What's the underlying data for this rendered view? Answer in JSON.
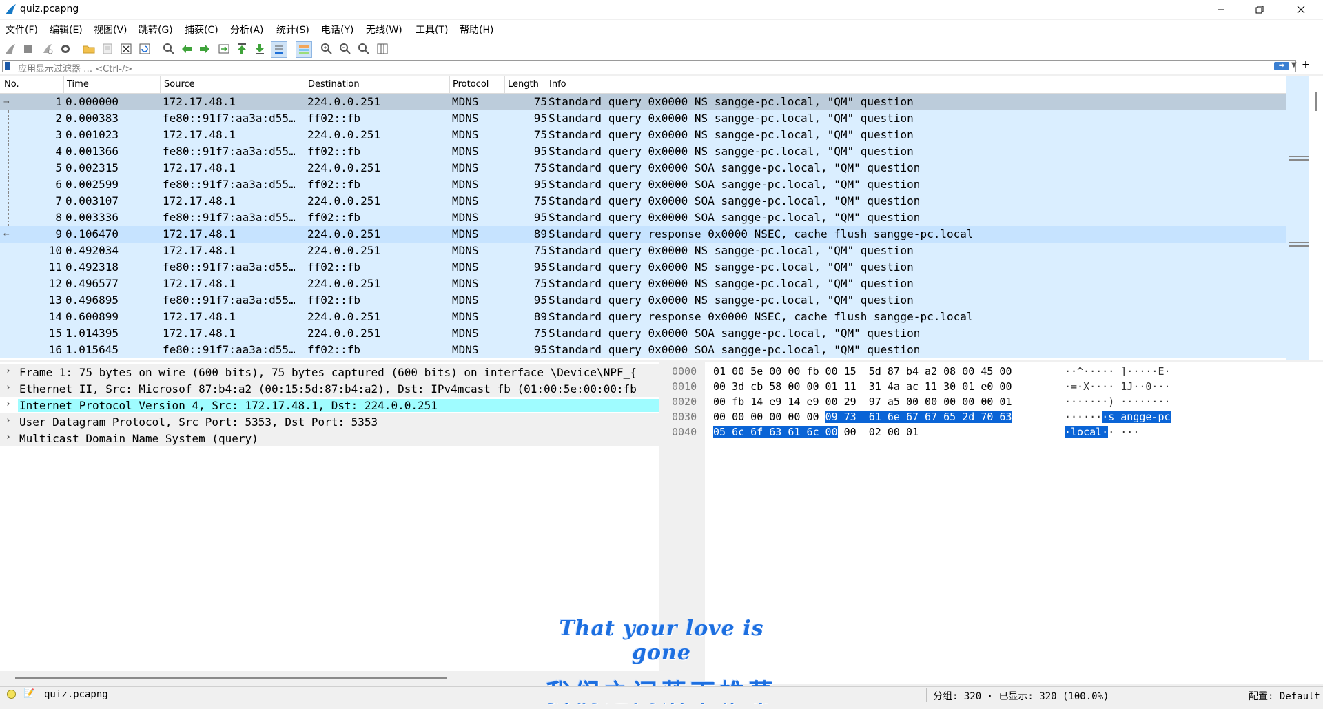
{
  "window": {
    "title": "quiz.pcapng"
  },
  "menu": [
    "文件(F)",
    "编辑(E)",
    "视图(V)",
    "跳转(G)",
    "捕获(C)",
    "分析(A)",
    "统计(S)",
    "电话(Y)",
    "无线(W)",
    "工具(T)",
    "帮助(H)"
  ],
  "toolbar": [
    "start-capture",
    "stop-capture",
    "restart-capture",
    "capture-options",
    "open-file",
    "save-file",
    "close-file",
    "reload-file",
    "find-packet",
    "go-back",
    "go-forward",
    "go-to-packet",
    "go-first",
    "go-last",
    "auto-scroll",
    "colorize",
    "zoom-in",
    "zoom-out",
    "zoom-normal",
    "resize-columns"
  ],
  "filter": {
    "placeholder": "应用显示过滤器 … <Ctrl-/>"
  },
  "packet_list": {
    "columns": [
      "No.",
      "Time",
      "Source",
      "Destination",
      "Protocol",
      "Length",
      "Info"
    ],
    "rows": [
      {
        "no": "1",
        "time": "0.000000",
        "src": "172.17.48.1",
        "dst": "224.0.0.251",
        "proto": "MDNS",
        "len": "75",
        "info": "Standard query 0x0000 NS sangge-pc.local, \"QM\" question"
      },
      {
        "no": "2",
        "time": "0.000383",
        "src": "fe80::91f7:aa3a:d55…",
        "dst": "ff02::fb",
        "proto": "MDNS",
        "len": "95",
        "info": "Standard query 0x0000 NS sangge-pc.local, \"QM\" question"
      },
      {
        "no": "3",
        "time": "0.001023",
        "src": "172.17.48.1",
        "dst": "224.0.0.251",
        "proto": "MDNS",
        "len": "75",
        "info": "Standard query 0x0000 NS sangge-pc.local, \"QM\" question"
      },
      {
        "no": "4",
        "time": "0.001366",
        "src": "fe80::91f7:aa3a:d55…",
        "dst": "ff02::fb",
        "proto": "MDNS",
        "len": "95",
        "info": "Standard query 0x0000 NS sangge-pc.local, \"QM\" question"
      },
      {
        "no": "5",
        "time": "0.002315",
        "src": "172.17.48.1",
        "dst": "224.0.0.251",
        "proto": "MDNS",
        "len": "75",
        "info": "Standard query 0x0000 SOA sangge-pc.local, \"QM\" question"
      },
      {
        "no": "6",
        "time": "0.002599",
        "src": "fe80::91f7:aa3a:d55…",
        "dst": "ff02::fb",
        "proto": "MDNS",
        "len": "95",
        "info": "Standard query 0x0000 SOA sangge-pc.local, \"QM\" question"
      },
      {
        "no": "7",
        "time": "0.003107",
        "src": "172.17.48.1",
        "dst": "224.0.0.251",
        "proto": "MDNS",
        "len": "75",
        "info": "Standard query 0x0000 SOA sangge-pc.local, \"QM\" question"
      },
      {
        "no": "8",
        "time": "0.003336",
        "src": "fe80::91f7:aa3a:d55…",
        "dst": "ff02::fb",
        "proto": "MDNS",
        "len": "95",
        "info": "Standard query 0x0000 SOA sangge-pc.local, \"QM\" question"
      },
      {
        "no": "9",
        "time": "0.106470",
        "src": "172.17.48.1",
        "dst": "224.0.0.251",
        "proto": "MDNS",
        "len": "89",
        "info": "Standard query response 0x0000 NSEC, cache flush sangge-pc.local"
      },
      {
        "no": "10",
        "time": "0.492034",
        "src": "172.17.48.1",
        "dst": "224.0.0.251",
        "proto": "MDNS",
        "len": "75",
        "info": "Standard query 0x0000 NS sangge-pc.local, \"QM\" question"
      },
      {
        "no": "11",
        "time": "0.492318",
        "src": "fe80::91f7:aa3a:d55…",
        "dst": "ff02::fb",
        "proto": "MDNS",
        "len": "95",
        "info": "Standard query 0x0000 NS sangge-pc.local, \"QM\" question"
      },
      {
        "no": "12",
        "time": "0.496577",
        "src": "172.17.48.1",
        "dst": "224.0.0.251",
        "proto": "MDNS",
        "len": "75",
        "info": "Standard query 0x0000 NS sangge-pc.local, \"QM\" question"
      },
      {
        "no": "13",
        "time": "0.496895",
        "src": "fe80::91f7:aa3a:d55…",
        "dst": "ff02::fb",
        "proto": "MDNS",
        "len": "95",
        "info": "Standard query 0x0000 NS sangge-pc.local, \"QM\" question"
      },
      {
        "no": "14",
        "time": "0.600899",
        "src": "172.17.48.1",
        "dst": "224.0.0.251",
        "proto": "MDNS",
        "len": "89",
        "info": "Standard query response 0x0000 NSEC, cache flush sangge-pc.local"
      },
      {
        "no": "15",
        "time": "1.014395",
        "src": "172.17.48.1",
        "dst": "224.0.0.251",
        "proto": "MDNS",
        "len": "75",
        "info": "Standard query 0x0000 SOA sangge-pc.local, \"QM\" question"
      },
      {
        "no": "16",
        "time": "1.015645",
        "src": "fe80::91f7:aa3a:d55…",
        "dst": "ff02::fb",
        "proto": "MDNS",
        "len": "95",
        "info": "Standard query 0x0000 SOA sangge-pc.local, \"QM\" question"
      }
    ]
  },
  "details": [
    "Frame 1: 75 bytes on wire (600 bits), 75 bytes captured (600 bits) on interface \\Device\\NPF_{",
    "Ethernet II, Src: Microsof_87:b4:a2 (00:15:5d:87:b4:a2), Dst: IPv4mcast_fb (01:00:5e:00:00:fb",
    "Internet Protocol Version 4, Src: 172.17.48.1, Dst: 224.0.0.251",
    "User Datagram Protocol, Src Port: 5353, Dst Port: 5353",
    "Multicast Domain Name System (query)"
  ],
  "bytes": {
    "offsets": [
      "0000",
      "0010",
      "0020",
      "0030",
      "0040"
    ],
    "rows": [
      {
        "hex": [
          "01 00 5e 00 00 fb 00 15  5d 87 b4 a2 08 00 45 00"
        ],
        "ascii": [
          "··^····· ]·····E·"
        ]
      },
      {
        "hex": [
          "00 3d cb 58 00 00 01 11  31 4a ac 11 30 01 e0 00"
        ],
        "ascii": [
          "·=·X···· 1J··0···"
        ]
      },
      {
        "hex": [
          "00 fb 14 e9 14 e9 00 29  97 a5 00 00 00 00 00 01"
        ],
        "ascii": [
          "·······) ········"
        ]
      },
      {
        "hex": [
          "00 00 00 00 00 00 ",
          "09 73  61 6e 67 67 65 2d 70 63"
        ],
        "ascii": [
          "······",
          "·s angge-pc"
        ]
      },
      {
        "hex": [
          "05 6c 6f 63 61 6c 00",
          " 00  02 00 01"
        ],
        "ascii": [
          "·local·",
          "· ···"
        ]
      }
    ]
  },
  "subtitle": {
    "en": "That your love is gone",
    "cn": "我们之间落下帷幕"
  },
  "status": {
    "file": "quiz.pcapng",
    "packets": "分组: 320 · 已显示: 320 (100.0%)",
    "profile": "配置: Default"
  }
}
